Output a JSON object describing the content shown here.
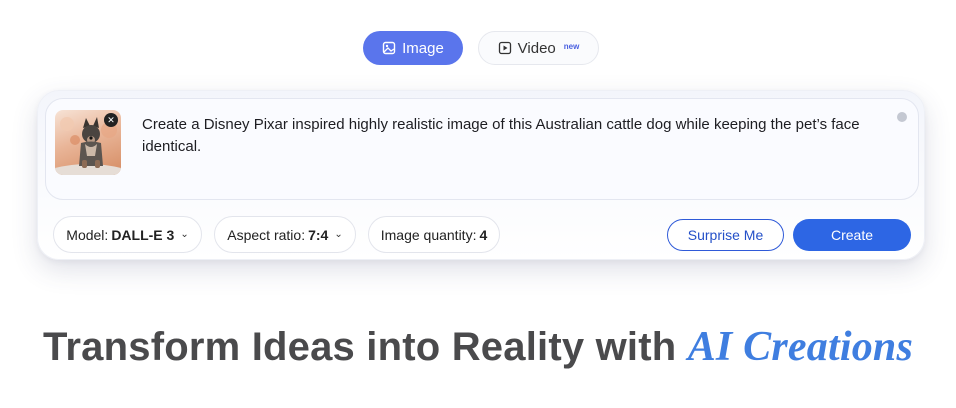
{
  "tabs": {
    "image_label": "Image",
    "video_label": "Video",
    "video_badge": "new"
  },
  "prompt": {
    "text": "Create a Disney Pixar inspired highly realistic image of this Australian cattle dog while keeping the pet’s face identical.",
    "thumbnail_icon": "dog-photo",
    "remove_icon": "close-icon",
    "clear_icon": "clear-icon"
  },
  "options": {
    "model_label": "Model:",
    "model_value": "DALL-E 3",
    "aspect_label": "Aspect ratio:",
    "aspect_value": "7:4",
    "quantity_label": "Image quantity:",
    "quantity_value": "4"
  },
  "actions": {
    "surprise_label": "Surprise Me",
    "create_label": "Create"
  },
  "headline": {
    "main": "Transform Ideas into Reality with ",
    "accent": "AI Creations"
  },
  "colors": {
    "active_tab": "#5a75ec",
    "create_button": "#2d66e4",
    "surprise_border": "#2f5ad8",
    "accent_text": "#3f7ee0",
    "headline_text": "#4a4a4c"
  }
}
